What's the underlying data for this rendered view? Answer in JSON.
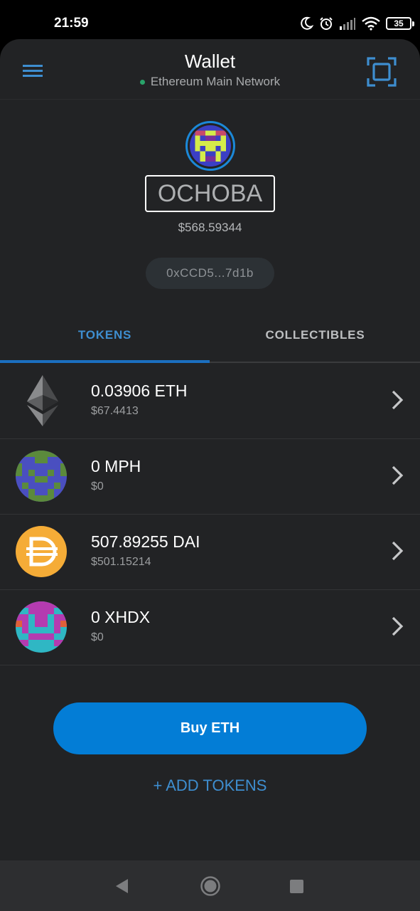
{
  "status_bar": {
    "time": "21:59",
    "battery": "35",
    "icons": [
      "moon-icon",
      "alarm-icon",
      "signal-icon",
      "wifi-icon",
      "battery-icon"
    ]
  },
  "header": {
    "title": "Wallet",
    "network": "Ethereum Main Network",
    "network_dot_color": "#29a36a",
    "menu_icon": "hamburger-menu-icon",
    "scan_icon": "qr-scan-icon"
  },
  "account": {
    "name": "OCHOBA",
    "balance": "$568.59344",
    "address": "0xCCD5...7d1b"
  },
  "tabs": [
    {
      "label": "TOKENS",
      "active": true
    },
    {
      "label": "COLLECTIBLES",
      "active": false
    }
  ],
  "tokens": [
    {
      "amount": "0.03906 ETH",
      "fiat": "$67.4413",
      "icon": "eth-icon"
    },
    {
      "amount": "0 MPH",
      "fiat": "$0",
      "icon": "mph-identicon"
    },
    {
      "amount": "507.89255 DAI",
      "fiat": "$501.15214",
      "icon": "dai-icon"
    },
    {
      "amount": "0 XHDX",
      "fiat": "$0",
      "icon": "xhdx-identicon"
    }
  ],
  "actions": {
    "buy_label": "Buy ETH",
    "add_tokens_label": "+ ADD TOKENS"
  },
  "colors": {
    "accent": "#037dd6",
    "link": "#3e8ed0",
    "background": "#222325"
  }
}
